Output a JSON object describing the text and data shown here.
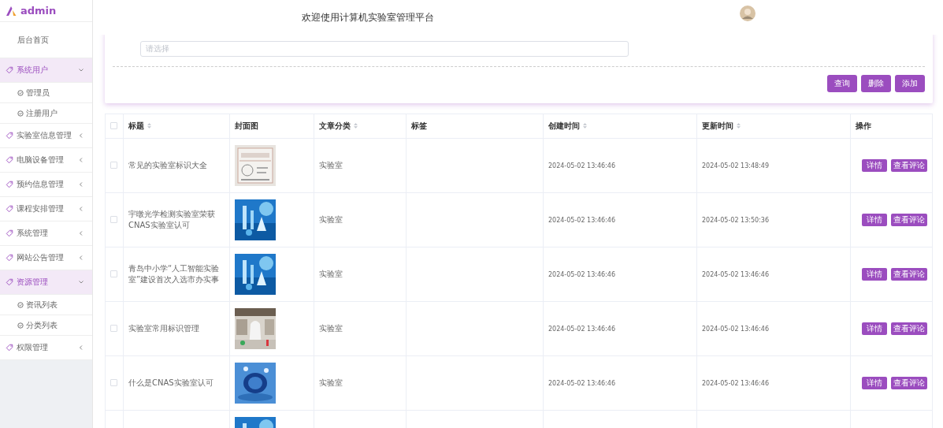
{
  "brand": {
    "name": "admin"
  },
  "header": {
    "title": "欢迎使用计算机实验室管理平台"
  },
  "sidebar": {
    "items": [
      {
        "kind": "link",
        "label": "后台首页"
      },
      {
        "kind": "group",
        "label": "系统用户",
        "expanded": true,
        "children": [
          {
            "label": "管理员"
          },
          {
            "label": "注册用户"
          }
        ]
      },
      {
        "kind": "group",
        "label": "实验室信息管理",
        "expanded": false
      },
      {
        "kind": "group",
        "label": "电脑设备管理",
        "expanded": false
      },
      {
        "kind": "group",
        "label": "预约信息管理",
        "expanded": false
      },
      {
        "kind": "group",
        "label": "课程安排管理",
        "expanded": false
      },
      {
        "kind": "group",
        "label": "系统管理",
        "expanded": false
      },
      {
        "kind": "group",
        "label": "网站公告管理",
        "expanded": false
      },
      {
        "kind": "group",
        "label": "资源管理",
        "expanded": true,
        "children": [
          {
            "label": "资讯列表"
          },
          {
            "label": "分类列表"
          }
        ]
      },
      {
        "kind": "group",
        "label": "权限管理",
        "expanded": false
      }
    ]
  },
  "search": {
    "placeholder": "请选择",
    "buttons": [
      "查询",
      "删除",
      "添加"
    ]
  },
  "table": {
    "all_checked": false,
    "columns": [
      {
        "label": "标题",
        "sortable": true
      },
      {
        "label": "封面图",
        "sortable": false
      },
      {
        "label": "文章分类",
        "sortable": true
      },
      {
        "label": "标签",
        "sortable": false
      },
      {
        "label": "创建时间",
        "sortable": true
      },
      {
        "label": "更新时间",
        "sortable": true
      },
      {
        "label": "操作",
        "sortable": false
      }
    ],
    "rows": [
      {
        "checked": false,
        "title": "常见的实验室标识大全",
        "cover": {
          "kind": "picture"
        },
        "category": "实验室",
        "created": "2024-05-02 13:46:46",
        "updated": "2024-05-02 13:48:49",
        "actions": [
          "详情",
          "查看评论"
        ]
      },
      {
        "checked": false,
        "title": "宇暾光学检测实验室荣获CNAS实验室认可",
        "cover": {
          "kind": "picture"
        },
        "category": "实验室",
        "created": "2024-05-02 13:46:46",
        "updated": "2024-05-02 13:50:36",
        "actions": [
          "详情",
          "查看评论"
        ]
      },
      {
        "checked": false,
        "title": "青岛中小学“人工智能实验室”建设首次入选市办实事",
        "cover": {
          "kind": "picture"
        },
        "category": "实验室",
        "created": "2024-05-02 13:46:46",
        "updated": "2024-05-02 13:46:46",
        "actions": [
          "详情",
          "查看评论"
        ]
      },
      {
        "checked": false,
        "title": "实验室常用标识管理",
        "cover": {
          "kind": "picture"
        },
        "category": "实验室",
        "created": "2024-05-02 13:46:46",
        "updated": "2024-05-02 13:46:46",
        "actions": [
          "详情",
          "查看评论"
        ]
      },
      {
        "checked": false,
        "title": "什么是CNAS实验室认可",
        "cover": {
          "kind": "picture"
        },
        "category": "实验室",
        "created": "2024-05-02 13:46:46",
        "updated": "2024-05-02 13:46:46",
        "actions": [
          "详情",
          "查看评论"
        ]
      },
      {
        "cover": {
          "kind": "picture"
        }
      }
    ]
  }
}
